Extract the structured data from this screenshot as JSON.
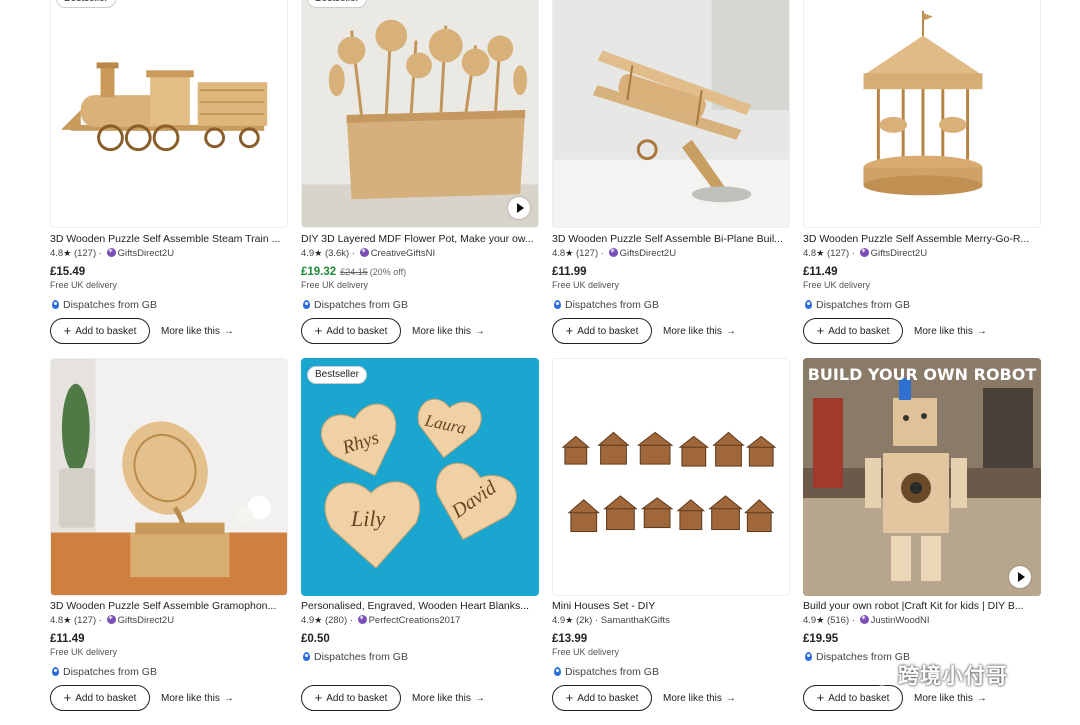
{
  "products": [
    {
      "badge": "Bestseller",
      "title": "3D Wooden Puzzle Self Assemble Steam Train ...",
      "rating": "4.8",
      "reviews": "(127)",
      "seller": "GiftsDirect2U",
      "price": "£15.49",
      "delivery": "Free UK delivery",
      "dispatch": "Dispatches from GB",
      "basket": "Add to basket",
      "more": "More like this"
    },
    {
      "badge": "Bestseller",
      "title": "DIY 3D Layered MDF Flower Pot, Make your ow...",
      "rating": "4.9",
      "reviews": "(3.6k)",
      "seller": "CreativeGiftsNI",
      "price": "£19.32",
      "was": "£24.15",
      "off": "(20% off)",
      "delivery": "Free UK delivery",
      "dispatch": "Dispatches from GB",
      "basket": "Add to basket",
      "more": "More like this"
    },
    {
      "title": "3D Wooden Puzzle Self Assemble Bi-Plane Buil...",
      "rating": "4.8",
      "reviews": "(127)",
      "seller": "GiftsDirect2U",
      "price": "£11.99",
      "delivery": "Free UK delivery",
      "dispatch": "Dispatches from GB",
      "basket": "Add to basket",
      "more": "More like this"
    },
    {
      "title": "3D Wooden Puzzle Self Assemble Merry-Go-R...",
      "rating": "4.8",
      "reviews": "(127)",
      "seller": "GiftsDirect2U",
      "price": "£11.49",
      "delivery": "Free UK delivery",
      "dispatch": "Dispatches from GB",
      "basket": "Add to basket",
      "more": "More like this"
    },
    {
      "title": "3D Wooden Puzzle Self Assemble Gramophon...",
      "rating": "4.8",
      "reviews": "(127)",
      "seller": "GiftsDirect2U",
      "price": "£11.49",
      "delivery": "Free UK delivery",
      "dispatch": "Dispatches from GB",
      "basket": "Add to basket",
      "more": "More like this"
    },
    {
      "badge": "Bestseller",
      "title": "Personalised, Engraved, Wooden Heart Blanks...",
      "rating": "4.9",
      "reviews": "(280)",
      "seller": "PerfectCreations2017",
      "price": "£0.50",
      "dispatch": "Dispatches from GB",
      "basket": "Add to basket",
      "more": "More like this",
      "hearts": [
        "Rhys",
        "Laura",
        "Lily",
        "David"
      ]
    },
    {
      "title": "Mini Houses Set - DIY",
      "rating": "4.9",
      "reviews": "(2k)",
      "seller": "SamanthaKGifts",
      "price": "£13.99",
      "delivery": "Free UK delivery",
      "dispatch": "Dispatches from GB",
      "basket": "Add to basket",
      "more": "More like this"
    },
    {
      "title": "Build your own robot |Craft Kit for kids | DIY B...",
      "rating": "4.9",
      "reviews": "(516)",
      "seller": "JustinWoodNI",
      "price": "£19.95",
      "dispatch": "Dispatches from GB",
      "basket": "Add to basket",
      "more": "More like this",
      "image_caption": "BUILD YOUR OWN ROBOT"
    }
  ],
  "watermark": "跨境小付哥",
  "colors": {
    "sale_price": "#1f8a3a",
    "seller_icon": "#7a4fb5",
    "pin": "#2a6fdb",
    "heart_bg": "#1ba6cf"
  }
}
